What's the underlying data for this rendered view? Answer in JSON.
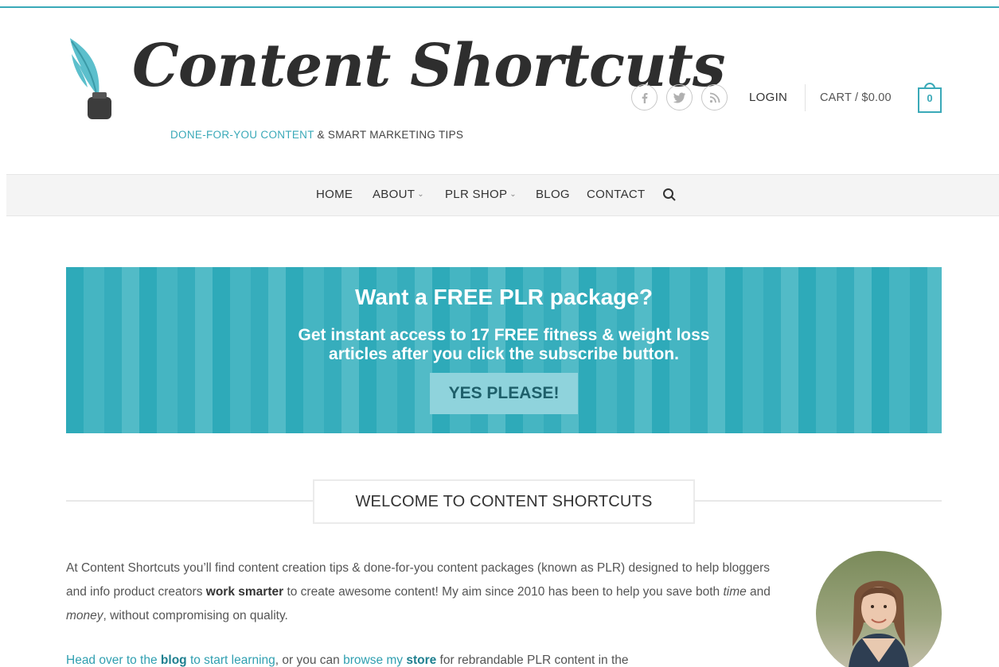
{
  "header": {
    "brand_name": "Content Shortcuts",
    "tagline_accent": "DONE-FOR-YOU CONTENT",
    "tagline_rest": " & SMART MARKETING TIPS",
    "social_icons": [
      "facebook-icon",
      "twitter-icon",
      "rss-icon"
    ],
    "login_label": "LOGIN",
    "cart_label": "CART / $0.00",
    "cart_count": "0"
  },
  "nav": {
    "items": [
      {
        "label": "HOME",
        "has_dropdown": false
      },
      {
        "label": "ABOUT",
        "has_dropdown": true
      },
      {
        "label": "PLR SHOP",
        "has_dropdown": true
      },
      {
        "label": "BLOG",
        "has_dropdown": false
      },
      {
        "label": "CONTACT",
        "has_dropdown": false
      }
    ],
    "dropdown_glyph": "⌄",
    "search_icon": "search-icon"
  },
  "banner": {
    "title": "Want a FREE PLR package?",
    "subtitle_line1": "Get instant access to 17 FREE fitness & weight loss",
    "subtitle_line2": "articles after you click the subscribe button.",
    "button_label": "YES PLEASE!"
  },
  "welcome": {
    "heading": "WELCOME TO CONTENT SHORTCUTS",
    "p1_a": "At Content Shortcuts you’ll find content creation tips & done-for-you content packages (known as PLR) designed to help bloggers and info product creators ",
    "p1_bold": "work smarter",
    "p1_b": " to create awesome content! My aim since 2010 has been to help you save both ",
    "p1_time": "time",
    "p1_c": " and ",
    "p1_money": "money",
    "p1_d": ", without compromising on quality.",
    "p2_link1_a": "Head over to the ",
    "p2_link1_bold": "blog",
    "p2_link1_b": " to start learning",
    "p2_mid": ", or you can ",
    "p2_link2_a": "browse my ",
    "p2_link2_bold": "store",
    "p2_end": " for rebrandable PLR content in the"
  },
  "colors": {
    "accent": "#3aa9b8",
    "banner_button": "#8fd3dc",
    "link": "#2f9fb0"
  }
}
